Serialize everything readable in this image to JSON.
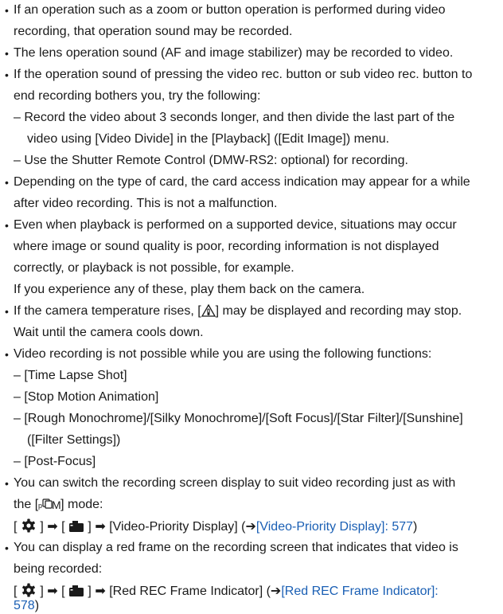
{
  "colors": {
    "text": "#1a1a1a",
    "link": "#1a5fb4"
  },
  "bullet": "•",
  "dash": "–",
  "arrow": "➡",
  "ref_arrow": "➔",
  "lines": {
    "l1": "If an operation such as a zoom or button operation is performed during video",
    "l2": "recording, that operation sound may be recorded.",
    "l3": "The lens operation sound (AF and image stabilizer) may be recorded to video.",
    "l4": "If the operation sound of pressing the video rec. button or sub video rec. button to",
    "l5": "end recording bothers you, try the following:",
    "l6": "Record the video about 3 seconds longer, and then divide the last part of the",
    "l7": "video using [Video Divide] in the [Playback] ([Edit Image]) menu.",
    "l8": "Use the Shutter Remote Control (DMW-RS2: optional) for recording.",
    "l9": "Depending on the type of card, the card access indication may appear for a while",
    "l10": "after video recording. This is not a malfunction.",
    "l11": "Even when playback is performed on a supported device, situations may occur",
    "l12": "where image or sound quality is poor, recording information is not displayed",
    "l13": "correctly, or playback is not possible, for example.",
    "l14": "If you experience any of these, play them back on the camera.",
    "l15a": "If the camera temperature rises, [",
    "l15b": "] may be displayed and recording may stop.",
    "l16": "Wait until the camera cools down.",
    "l17": "Video recording is not possible while you are using the following functions:",
    "l18": "[Time Lapse Shot]",
    "l19": "[Stop Motion Animation]",
    "l20": "[Rough Monochrome]/[Silky Monochrome]/[Soft Focus]/[Star Filter]/[Sunshine]",
    "l21": "([Filter Settings])",
    "l22": "[Post-Focus]",
    "l23": "You can switch the recording screen display to suit video recording just as with",
    "l24a": "the [",
    "l24b": "] mode:",
    "l25_item": "[Video-Priority Display] (",
    "l25_link": "[Video-Priority Display]: 577",
    "l25_end": ")",
    "l26": "You can display a red frame on the recording screen that indicates that video is",
    "l27": "being recorded:",
    "l28_item": "[Red REC Frame Indicator] (",
    "l28_link": "[Red REC Frame Indicator]:",
    "l29_link": "578",
    "l29_end": ")"
  }
}
